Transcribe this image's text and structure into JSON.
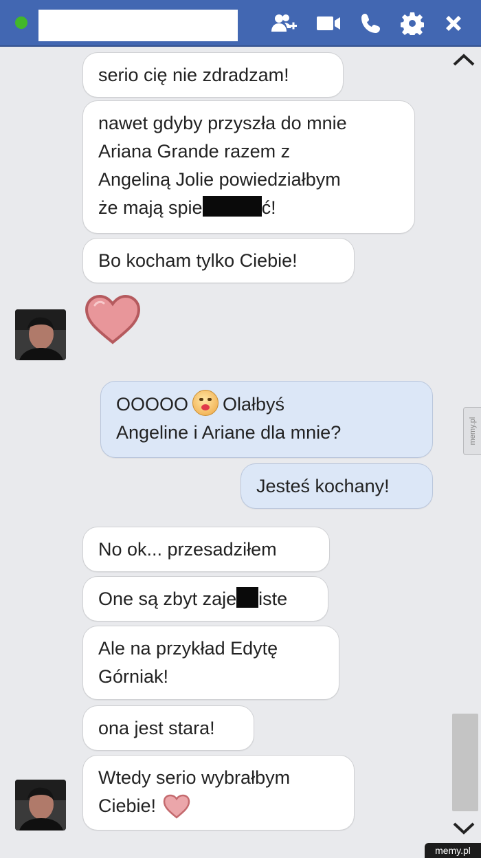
{
  "header": {
    "contact_name": "",
    "icons": [
      "add-person-icon",
      "video-camera-icon",
      "phone-icon",
      "gear-icon",
      "close-icon"
    ],
    "colors": {
      "bar": "#4267b2",
      "online": "#42b72a"
    }
  },
  "messages": [
    {
      "side": "in",
      "lines": [
        "serio cię nie zdradzam!"
      ]
    },
    {
      "side": "in",
      "lines": [
        "nawet gdyby przyszła do mnie",
        "Ariana Grande razem z",
        "Angeliną Jolie powiedziałbym"
      ],
      "last_line": {
        "before": "że mają spie",
        "after": "ć!"
      }
    },
    {
      "side": "in",
      "lines": [
        "Bo kocham tylko Ciebie!"
      ]
    },
    {
      "side": "out",
      "first": {
        "before": "OOOOO",
        "after": "Olałbyś"
      },
      "lines": [
        "Angeline i Ariane dla mnie?"
      ]
    },
    {
      "side": "out",
      "lines": [
        "Jesteś kochany!"
      ]
    },
    {
      "side": "in",
      "lines": [
        "No ok... przesadziłem"
      ]
    },
    {
      "side": "in",
      "censored": {
        "before": "One są zbyt zaje",
        "after": "iste"
      }
    },
    {
      "side": "in",
      "lines": [
        "Ale na przykład Edytę",
        "Górniak!"
      ]
    },
    {
      "side": "in",
      "lines": [
        "ona jest stara!"
      ]
    },
    {
      "side": "in",
      "lines": [
        "Wtedy serio wybrałbym",
        "Ciebie!"
      ]
    }
  ],
  "watermark": {
    "side": "memy.pl",
    "brand": "memy.pl"
  }
}
